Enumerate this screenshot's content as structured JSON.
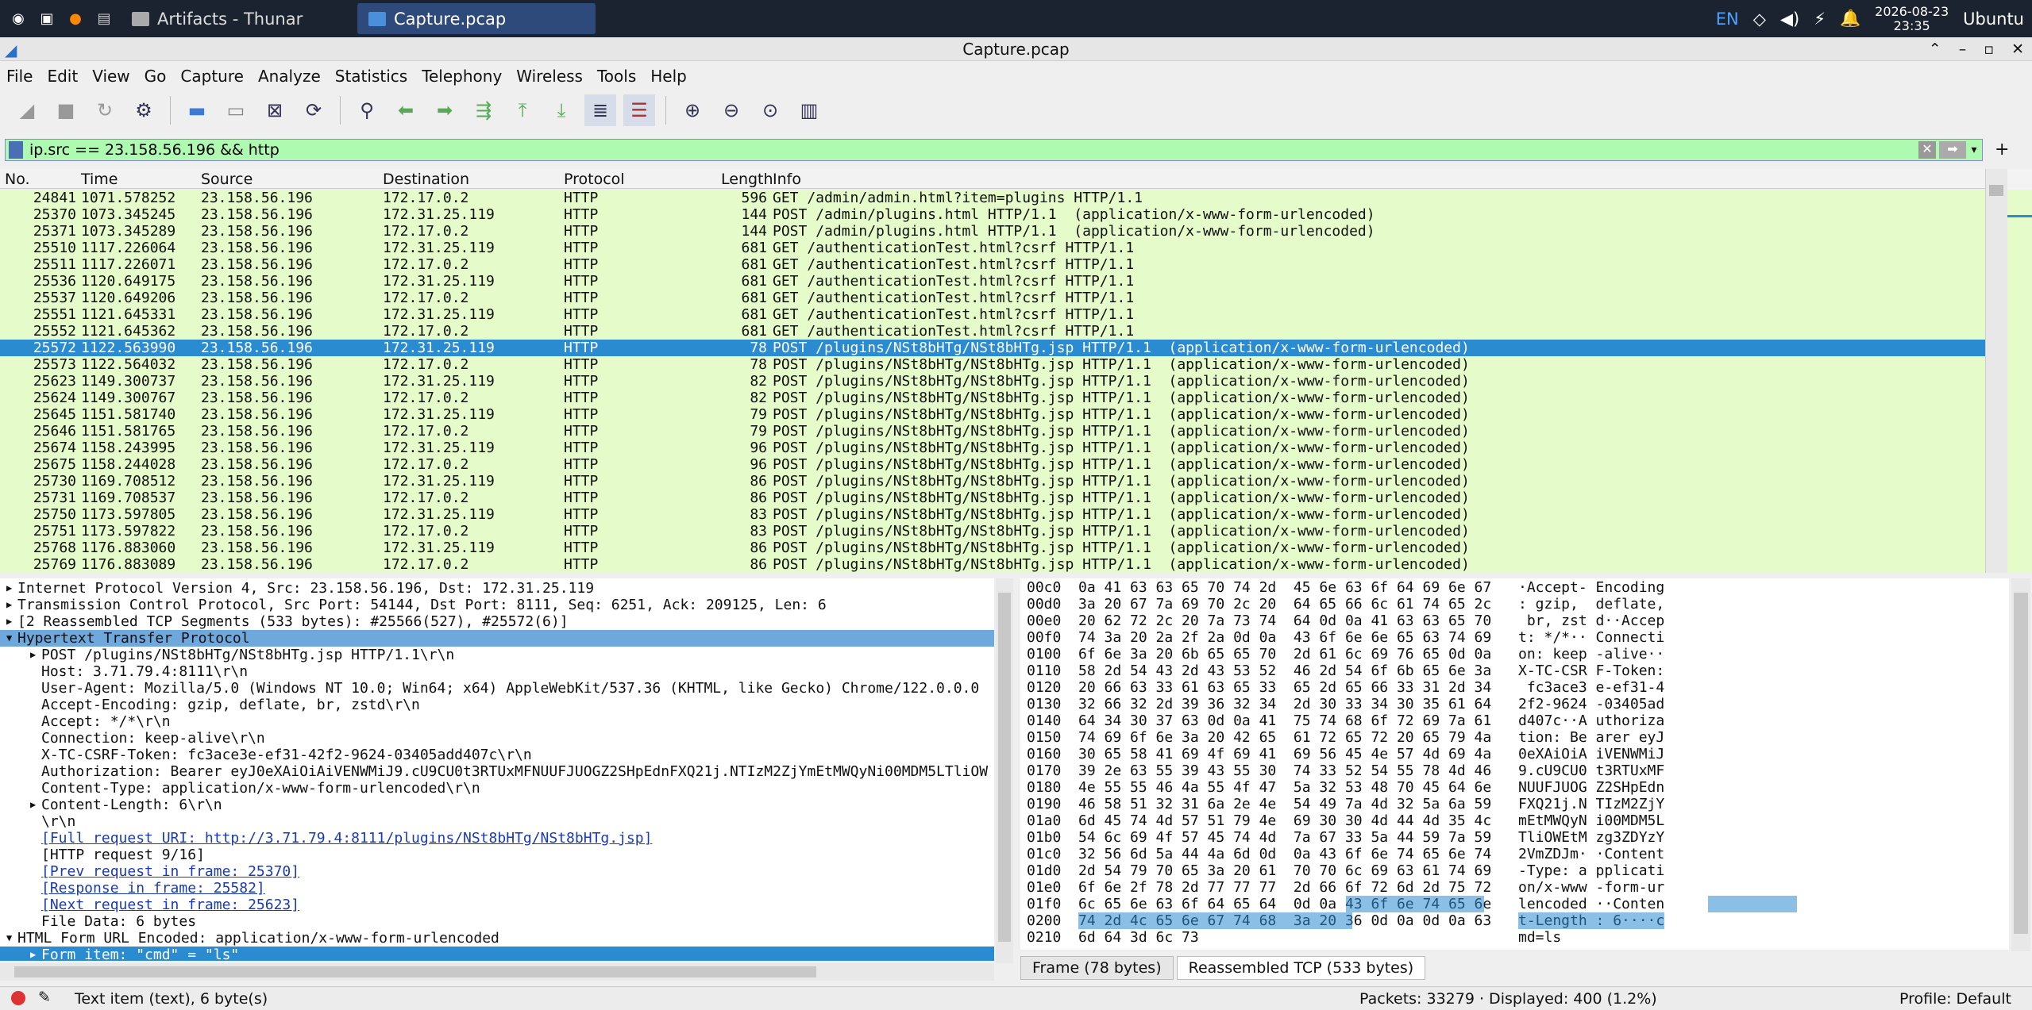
{
  "taskbar": {
    "tasks": [
      {
        "label": "Artifacts - Thunar"
      },
      {
        "label": "Capture.pcap"
      }
    ],
    "lang": "EN",
    "date": "2026-08-23",
    "time": "23:35",
    "user": "Ubuntu"
  },
  "window": {
    "title": "Capture.pcap"
  },
  "menu": [
    "File",
    "Edit",
    "View",
    "Go",
    "Capture",
    "Analyze",
    "Statistics",
    "Telephony",
    "Wireless",
    "Tools",
    "Help"
  ],
  "filter": {
    "value": "ip.src == 23.158.56.196 && http"
  },
  "columns": [
    "No.",
    "Time",
    "Source",
    "Destination",
    "Protocol",
    "Length",
    "Info"
  ],
  "packets": [
    [
      "24841",
      "1071.578252",
      "23.158.56.196",
      "172.17.0.2",
      "HTTP",
      "596",
      "GET /admin/admin.html?item=plugins HTTP/1.1"
    ],
    [
      "25370",
      "1073.345245",
      "23.158.56.196",
      "172.31.25.119",
      "HTTP",
      "144",
      "POST /admin/plugins.html HTTP/1.1  (application/x-www-form-urlencoded)"
    ],
    [
      "25371",
      "1073.345289",
      "23.158.56.196",
      "172.17.0.2",
      "HTTP",
      "144",
      "POST /admin/plugins.html HTTP/1.1  (application/x-www-form-urlencoded)"
    ],
    [
      "25510",
      "1117.226064",
      "23.158.56.196",
      "172.31.25.119",
      "HTTP",
      "681",
      "GET /authenticationTest.html?csrf HTTP/1.1"
    ],
    [
      "25511",
      "1117.226071",
      "23.158.56.196",
      "172.17.0.2",
      "HTTP",
      "681",
      "GET /authenticationTest.html?csrf HTTP/1.1"
    ],
    [
      "25536",
      "1120.649175",
      "23.158.56.196",
      "172.31.25.119",
      "HTTP",
      "681",
      "GET /authenticationTest.html?csrf HTTP/1.1"
    ],
    [
      "25537",
      "1120.649206",
      "23.158.56.196",
      "172.17.0.2",
      "HTTP",
      "681",
      "GET /authenticationTest.html?csrf HTTP/1.1"
    ],
    [
      "25551",
      "1121.645331",
      "23.158.56.196",
      "172.31.25.119",
      "HTTP",
      "681",
      "GET /authenticationTest.html?csrf HTTP/1.1"
    ],
    [
      "25552",
      "1121.645362",
      "23.158.56.196",
      "172.17.0.2",
      "HTTP",
      "681",
      "GET /authenticationTest.html?csrf HTTP/1.1"
    ],
    [
      "25572",
      "1122.563990",
      "23.158.56.196",
      "172.31.25.119",
      "HTTP",
      "78",
      "POST /plugins/NSt8bHTg/NSt8bHTg.jsp HTTP/1.1  (application/x-www-form-urlencoded)"
    ],
    [
      "25573",
      "1122.564032",
      "23.158.56.196",
      "172.17.0.2",
      "HTTP",
      "78",
      "POST /plugins/NSt8bHTg/NSt8bHTg.jsp HTTP/1.1  (application/x-www-form-urlencoded)"
    ],
    [
      "25623",
      "1149.300737",
      "23.158.56.196",
      "172.31.25.119",
      "HTTP",
      "82",
      "POST /plugins/NSt8bHTg/NSt8bHTg.jsp HTTP/1.1  (application/x-www-form-urlencoded)"
    ],
    [
      "25624",
      "1149.300767",
      "23.158.56.196",
      "172.17.0.2",
      "HTTP",
      "82",
      "POST /plugins/NSt8bHTg/NSt8bHTg.jsp HTTP/1.1  (application/x-www-form-urlencoded)"
    ],
    [
      "25645",
      "1151.581740",
      "23.158.56.196",
      "172.31.25.119",
      "HTTP",
      "79",
      "POST /plugins/NSt8bHTg/NSt8bHTg.jsp HTTP/1.1  (application/x-www-form-urlencoded)"
    ],
    [
      "25646",
      "1151.581765",
      "23.158.56.196",
      "172.17.0.2",
      "HTTP",
      "79",
      "POST /plugins/NSt8bHTg/NSt8bHTg.jsp HTTP/1.1  (application/x-www-form-urlencoded)"
    ],
    [
      "25674",
      "1158.243995",
      "23.158.56.196",
      "172.31.25.119",
      "HTTP",
      "96",
      "POST /plugins/NSt8bHTg/NSt8bHTg.jsp HTTP/1.1  (application/x-www-form-urlencoded)"
    ],
    [
      "25675",
      "1158.244028",
      "23.158.56.196",
      "172.17.0.2",
      "HTTP",
      "96",
      "POST /plugins/NSt8bHTg/NSt8bHTg.jsp HTTP/1.1  (application/x-www-form-urlencoded)"
    ],
    [
      "25730",
      "1169.708512",
      "23.158.56.196",
      "172.31.25.119",
      "HTTP",
      "86",
      "POST /plugins/NSt8bHTg/NSt8bHTg.jsp HTTP/1.1  (application/x-www-form-urlencoded)"
    ],
    [
      "25731",
      "1169.708537",
      "23.158.56.196",
      "172.17.0.2",
      "HTTP",
      "86",
      "POST /plugins/NSt8bHTg/NSt8bHTg.jsp HTTP/1.1  (application/x-www-form-urlencoded)"
    ],
    [
      "25750",
      "1173.597805",
      "23.158.56.196",
      "172.31.25.119",
      "HTTP",
      "83",
      "POST /plugins/NSt8bHTg/NSt8bHTg.jsp HTTP/1.1  (application/x-www-form-urlencoded)"
    ],
    [
      "25751",
      "1173.597822",
      "23.158.56.196",
      "172.17.0.2",
      "HTTP",
      "83",
      "POST /plugins/NSt8bHTg/NSt8bHTg.jsp HTTP/1.1  (application/x-www-form-urlencoded)"
    ],
    [
      "25768",
      "1176.883060",
      "23.158.56.196",
      "172.31.25.119",
      "HTTP",
      "86",
      "POST /plugins/NSt8bHTg/NSt8bHTg.jsp HTTP/1.1  (application/x-www-form-urlencoded)"
    ],
    [
      "25769",
      "1176.883089",
      "23.158.56.196",
      "172.17.0.2",
      "HTTP",
      "86",
      "POST /plugins/NSt8bHTg/NSt8bHTg.jsp HTTP/1.1  (application/x-www-form-urlencoded)"
    ]
  ],
  "selected_packet": "25572",
  "details": [
    {
      "ind": 0,
      "arrow": "▶",
      "text": "Internet Protocol Version 4, Src: 23.158.56.196, Dst: 172.31.25.119"
    },
    {
      "ind": 0,
      "arrow": "▶",
      "text": "Transmission Control Protocol, Src Port: 54144, Dst Port: 8111, Seq: 6251, Ack: 209125, Len: 6"
    },
    {
      "ind": 0,
      "arrow": "▶",
      "text": "[2 Reassembled TCP Segments (533 bytes): #25566(527), #25572(6)]"
    },
    {
      "ind": 0,
      "arrow": "▼",
      "text": "Hypertext Transfer Protocol",
      "cls": "sel1"
    },
    {
      "ind": 1,
      "arrow": "▶",
      "text": "POST /plugins/NSt8bHTg/NSt8bHTg.jsp HTTP/1.1\\r\\n"
    },
    {
      "ind": 1,
      "arrow": "",
      "text": "Host: 3.71.79.4:8111\\r\\n"
    },
    {
      "ind": 1,
      "arrow": "",
      "text": "User-Agent: Mozilla/5.0 (Windows NT 10.0; Win64; x64) AppleWebKit/537.36 (KHTML, like Gecko) Chrome/122.0.0.0"
    },
    {
      "ind": 1,
      "arrow": "",
      "text": "Accept-Encoding: gzip, deflate, br, zstd\\r\\n"
    },
    {
      "ind": 1,
      "arrow": "",
      "text": "Accept: */*\\r\\n"
    },
    {
      "ind": 1,
      "arrow": "",
      "text": "Connection: keep-alive\\r\\n"
    },
    {
      "ind": 1,
      "arrow": "",
      "text": "X-TC-CSRF-Token: fc3ace3e-ef31-42f2-9624-03405add407c\\r\\n"
    },
    {
      "ind": 1,
      "arrow": "",
      "text": "Authorization: Bearer eyJ0eXAiOiAiVENWMiJ9.cU9CU0t3RTUxMFNUUFJUOGZ2SHpEdnFXQ21j.NTIzM2ZjYmEtMWQyNi00MDM5LTliOW"
    },
    {
      "ind": 1,
      "arrow": "",
      "text": "Content-Type: application/x-www-form-urlencoded\\r\\n"
    },
    {
      "ind": 1,
      "arrow": "▶",
      "text": "Content-Length: 6\\r\\n"
    },
    {
      "ind": 1,
      "arrow": "",
      "text": "\\r\\n"
    },
    {
      "ind": 1,
      "arrow": "",
      "text": "[Full request URI: http://3.71.79.4:8111/plugins/NSt8bHTg/NSt8bHTg.jsp]",
      "link": true
    },
    {
      "ind": 1,
      "arrow": "",
      "text": "[HTTP request 9/16]"
    },
    {
      "ind": 1,
      "arrow": "",
      "text": "[Prev request in frame: 25370]",
      "link": true
    },
    {
      "ind": 1,
      "arrow": "",
      "text": "[Response in frame: 25582]",
      "link": true
    },
    {
      "ind": 1,
      "arrow": "",
      "text": "[Next request in frame: 25623]",
      "link": true
    },
    {
      "ind": 1,
      "arrow": "",
      "text": "File Data: 6 bytes"
    },
    {
      "ind": 0,
      "arrow": "▼",
      "text": "HTML Form URL Encoded: application/x-www-form-urlencoded"
    },
    {
      "ind": 1,
      "arrow": "▶",
      "text": "Form item: \"cmd\" = \"ls\"",
      "cls": "sel2"
    }
  ],
  "hex": [
    [
      "00c0",
      "0a 41 63 63 65 70 74 2d  45 6e 63 6f 64 69 6e 67",
      "·Accept- Encoding"
    ],
    [
      "00d0",
      "3a 20 67 7a 69 70 2c 20  64 65 66 6c 61 74 65 2c",
      ": gzip,  deflate,"
    ],
    [
      "00e0",
      "20 62 72 2c 20 7a 73 74  64 0d 0a 41 63 63 65 70",
      " br, zst d··Accep"
    ],
    [
      "00f0",
      "74 3a 20 2a 2f 2a 0d 0a  43 6f 6e 6e 65 63 74 69",
      "t: */*·· Connecti"
    ],
    [
      "0100",
      "6f 6e 3a 20 6b 65 65 70  2d 61 6c 69 76 65 0d 0a",
      "on: keep -alive··"
    ],
    [
      "0110",
      "58 2d 54 43 2d 43 53 52  46 2d 54 6f 6b 65 6e 3a",
      "X-TC-CSR F-Token:"
    ],
    [
      "0120",
      "20 66 63 33 61 63 65 33  65 2d 65 66 33 31 2d 34",
      " fc3ace3 e-ef31-4"
    ],
    [
      "0130",
      "32 66 32 2d 39 36 32 34  2d 30 33 34 30 35 61 64",
      "2f2-9624 -03405ad"
    ],
    [
      "0140",
      "64 34 30 37 63 0d 0a 41  75 74 68 6f 72 69 7a 61",
      "d407c··A uthoriza"
    ],
    [
      "0150",
      "74 69 6f 6e 3a 20 42 65  61 72 65 72 20 65 79 4a",
      "tion: Be arer eyJ"
    ],
    [
      "0160",
      "30 65 58 41 69 4f 69 41  69 56 45 4e 57 4d 69 4a",
      "0eXAiOiA iVENWMiJ"
    ],
    [
      "0170",
      "39 2e 63 55 39 43 55 30  74 33 52 54 55 78 4d 46",
      "9.cU9CU0 t3RTUxMF"
    ],
    [
      "0180",
      "4e 55 55 46 4a 55 4f 47  5a 32 53 48 70 45 64 6e",
      "NUUFJUOG Z2SHpEdn"
    ],
    [
      "0190",
      "46 58 51 32 31 6a 2e 4e  54 49 7a 4d 32 5a 6a 59",
      "FXQ21j.N TIzM2ZjY"
    ],
    [
      "01a0",
      "6d 45 74 4d 57 51 79 4e  69 30 30 4d 44 4d 35 4c",
      "mEtMWQyN i00MDM5L"
    ],
    [
      "01b0",
      "54 6c 69 4f 57 45 74 4d  7a 67 33 5a 44 59 7a 59",
      "TliOWEtM zg3ZDYzY"
    ],
    [
      "01c0",
      "32 56 6d 5a 44 4a 6d 0d  0a 43 6f 6e 74 65 6e 74",
      "2VmZDJm· ·Content"
    ],
    [
      "01d0",
      "2d 54 79 70 65 3a 20 61  70 70 6c 69 63 61 74 69",
      "-Type: a pplicati"
    ],
    [
      "01e0",
      "6f 6e 2f 78 2d 77 77 77  2d 66 6f 72 6d 2d 75 72",
      "on/x-www -form-ur"
    ],
    [
      "01f0",
      "6c 65 6e 63 6f 64 65 64  0d 0a 43 6f 6e 74 65 6e",
      "lencoded ··Conten"
    ],
    [
      "0200",
      "74 2d 4c 65 6e 67 74 68  3a 20 36 0d 0a 0d 0a 63",
      "t-Length : 6····c"
    ],
    [
      "0210",
      "6d 64 3d 6c 73",
      "md=ls"
    ]
  ],
  "hextabs": [
    "Frame (78 bytes)",
    "Reassembled TCP (533 bytes)"
  ],
  "status": {
    "left": "Text item (text), 6 byte(s)",
    "packets": "Packets: 33279 · Displayed: 400 (1.2%)",
    "profile": "Profile: Default"
  },
  "colors": {
    "row_bg": "#e5fbc9",
    "selected": "#2b8bd1",
    "filter_bg": "#aefab0"
  }
}
